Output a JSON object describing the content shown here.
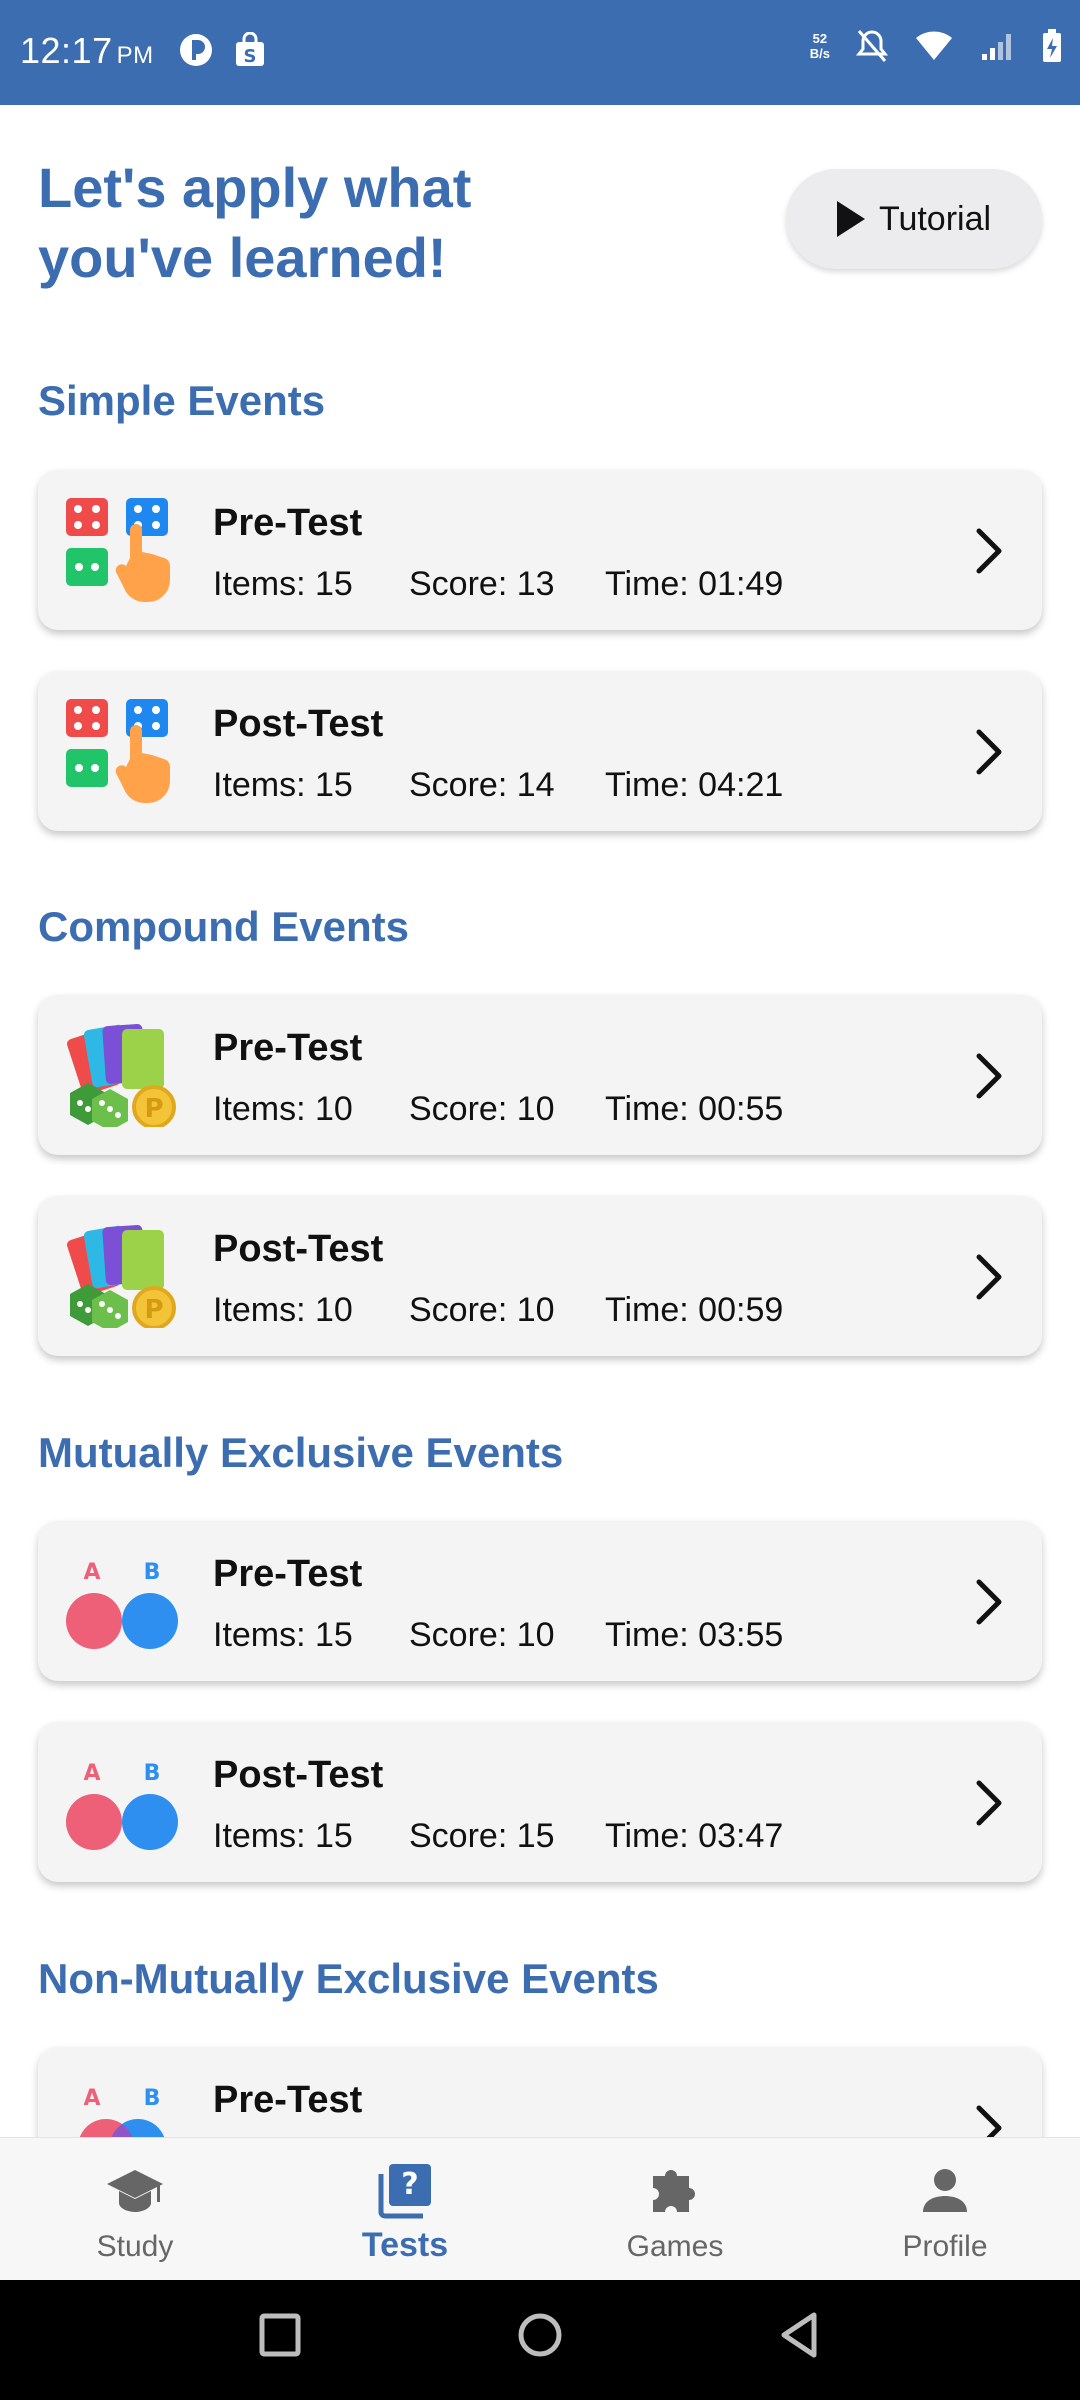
{
  "status_bar": {
    "time": "12:17",
    "ampm": "PM",
    "net_speed_value": "52",
    "net_speed_unit": "B/s",
    "icons": [
      "app-notification-icon",
      "shopping-bag-icon",
      "mute-icon",
      "wifi-icon",
      "signal-icon",
      "battery-charging-icon"
    ]
  },
  "header": {
    "title": "Let's apply what you've learned!",
    "tutorial_label": "Tutorial"
  },
  "sections": [
    {
      "title": "Simple Events",
      "icon": "dice-hand-icon",
      "tests": [
        {
          "name": "Pre-Test",
          "items": "Items: 15",
          "score": "Score: 13",
          "time": "Time: 01:49"
        },
        {
          "name": "Post-Test",
          "items": "Items: 15",
          "score": "Score: 14",
          "time": "Time: 04:21"
        }
      ]
    },
    {
      "title": "Compound Events",
      "icon": "cards-dice-coin-icon",
      "tests": [
        {
          "name": "Pre-Test",
          "items": "Items: 10",
          "score": "Score: 10",
          "time": "Time: 00:55"
        },
        {
          "name": "Post-Test",
          "items": "Items: 10",
          "score": "Score: 10",
          "time": "Time: 00:59"
        }
      ]
    },
    {
      "title": "Mutually Exclusive Events",
      "icon": "disjoint-circles-icon",
      "tests": [
        {
          "name": "Pre-Test",
          "items": "Items: 15",
          "score": "Score: 10",
          "time": "Time: 03:55"
        },
        {
          "name": "Post-Test",
          "items": "Items: 15",
          "score": "Score: 15",
          "time": "Time: 03:47"
        }
      ]
    },
    {
      "title": "Non-Mutually Exclusive Events",
      "icon": "overlapping-circles-icon",
      "tests": [
        {
          "name": "Pre-Test"
        }
      ]
    }
  ],
  "bottom_nav": [
    {
      "label": "Study",
      "icon": "graduation-cap-icon",
      "active": false
    },
    {
      "label": "Tests",
      "icon": "quiz-icon",
      "active": true
    },
    {
      "label": "Games",
      "icon": "puzzle-icon",
      "active": false
    },
    {
      "label": "Profile",
      "icon": "person-icon",
      "active": false
    }
  ],
  "colors": {
    "primary": "#3c6db0",
    "card_bg": "#f4f4f4",
    "inactive_nav": "#666666"
  }
}
